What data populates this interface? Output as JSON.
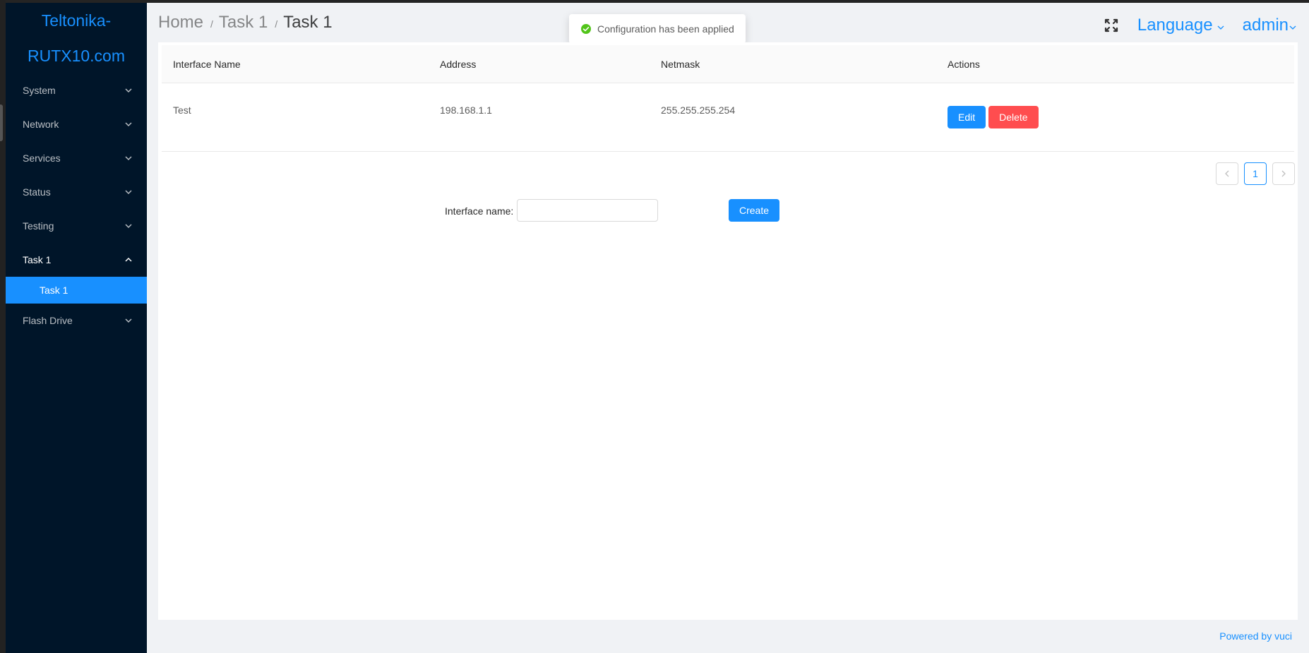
{
  "brand": {
    "line1": "Teltonika-",
    "line2": "RUTX10.com"
  },
  "sidebar": {
    "items": [
      {
        "label": "System"
      },
      {
        "label": "Network"
      },
      {
        "label": "Services"
      },
      {
        "label": "Status"
      },
      {
        "label": "Testing"
      },
      {
        "label": "Task 1"
      },
      {
        "label": "Flash Drive"
      }
    ],
    "submenu": {
      "label": "Task 1"
    }
  },
  "breadcrumb": {
    "home": "Home",
    "sep1": "/",
    "level1": "Task 1",
    "sep2": "/",
    "current": "Task 1"
  },
  "toast": {
    "message": "Configuration has been applied"
  },
  "header": {
    "language": "Language",
    "user": "admin"
  },
  "table": {
    "headers": [
      "Interface Name",
      "Address",
      "Netmask",
      "Actions"
    ],
    "rows": [
      {
        "name": "Test",
        "address": "198.168.1.1",
        "netmask": "255.255.255.254"
      }
    ],
    "edit_label": "Edit",
    "delete_label": "Delete"
  },
  "pagination": {
    "current_page": "1"
  },
  "form": {
    "label": "Interface name:",
    "value": "",
    "create_label": "Create"
  },
  "footer": {
    "text": "Powered by vuci"
  },
  "colors": {
    "primary": "#1890ff",
    "danger": "#ff4d4f",
    "sidebar_bg": "#001529",
    "success": "#52c41a"
  },
  "icons": [
    "chevron-down-icon",
    "chevron-up-icon",
    "fullscreen-icon",
    "check-circle-icon",
    "chevron-left-icon",
    "chevron-right-icon"
  ]
}
